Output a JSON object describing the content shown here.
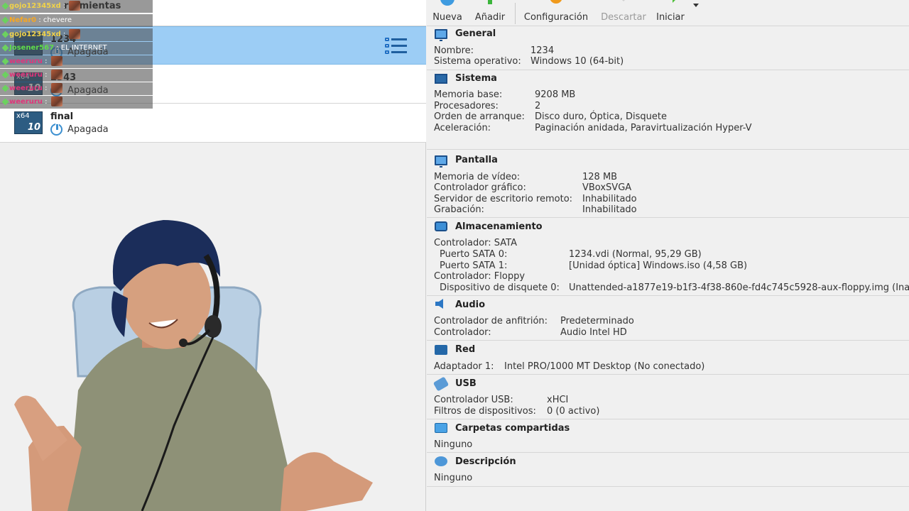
{
  "vm_list": {
    "tools_label": "rramientas",
    "selected": {
      "name": "1234",
      "state": "Apagada"
    },
    "items": [
      {
        "name": "2343",
        "state": "Apagada",
        "thumb_arch": "x64",
        "thumb_ver": "10"
      },
      {
        "name": "final",
        "state": "Apagada",
        "thumb_arch": "x64",
        "thumb_ver": "10"
      }
    ],
    "view_icon": "list-view-icon"
  },
  "chat": [
    {
      "user": "gojo12345xd",
      "msg": "",
      "user_color": "#f0d24a"
    },
    {
      "user": "Nefar0",
      "msg": "chevere",
      "user_color": "#f5a623"
    },
    {
      "user": "gojo12345xd",
      "msg": "",
      "user_color": "#f0d24a"
    },
    {
      "user": "Josener567",
      "msg": "EL INTERNET",
      "user_color": "#5fdc4a"
    },
    {
      "user": "weeruru",
      "msg": "",
      "user_color": "#e0357a"
    },
    {
      "user": "weeruru",
      "msg": "",
      "user_color": "#e0357a"
    },
    {
      "user": "weeruru",
      "msg": "",
      "user_color": "#e0357a"
    },
    {
      "user": "weeruru",
      "msg": "",
      "user_color": "#e0357a"
    }
  ],
  "toolbar": {
    "nueva": "Nueva",
    "anadir": "Añadir",
    "configuracion": "Configuración",
    "descartar": "Descartar",
    "iniciar": "Iniciar"
  },
  "details": {
    "general": {
      "title": "General",
      "rows": [
        {
          "k": "Nombre:",
          "v": "1234"
        },
        {
          "k": "Sistema operativo:",
          "v": "Windows 10 (64-bit)"
        }
      ]
    },
    "sistema": {
      "title": "Sistema",
      "rows": [
        {
          "k": "Memoria base:",
          "v": "9208 MB"
        },
        {
          "k": "Procesadores:",
          "v": "2"
        },
        {
          "k": "Orden de arranque:",
          "v": "Disco duro, Óptica, Disquete"
        },
        {
          "k": "Aceleración:",
          "v": "Paginación anidada, Paravirtualización Hyper-V"
        }
      ]
    },
    "pantalla": {
      "title": "Pantalla",
      "rows": [
        {
          "k": "Memoria de vídeo:",
          "v": "128 MB"
        },
        {
          "k": "Controlador gráfico:",
          "v": "VBoxSVGA"
        },
        {
          "k": "Servidor de escritorio remoto:",
          "v": "Inhabilitado"
        },
        {
          "k": "Grabación:",
          "v": "Inhabilitado"
        }
      ]
    },
    "almacenamiento": {
      "title": "Almacenamiento",
      "rows": [
        {
          "k": "Controlador: SATA",
          "v": ""
        },
        {
          "k": "Puerto SATA 0:",
          "v": "1234.vdi (Normal, 95,29 GB)"
        },
        {
          "k": "Puerto SATA 1:",
          "v": "[Unidad óptica] Windows.iso (4,58 GB)"
        },
        {
          "k": "Controlador: Floppy",
          "v": ""
        },
        {
          "k": "Dispositivo de disquete 0:",
          "v": "Unattended-a1877e19-b1f3-4f38-860e-fd4c745c5928-aux-floppy.img (Ina"
        }
      ]
    },
    "audio": {
      "title": "Audio",
      "rows": [
        {
          "k": "Controlador de anfitrión:",
          "v": "Predeterminado"
        },
        {
          "k": "Controlador:",
          "v": "Audio Intel HD"
        }
      ]
    },
    "red": {
      "title": "Red",
      "rows": [
        {
          "k": "Adaptador 1:",
          "v": "Intel PRO/1000 MT Desktop (No conectado)"
        }
      ]
    },
    "usb": {
      "title": "USB",
      "rows": [
        {
          "k": "Controlador USB:",
          "v": "xHCI"
        },
        {
          "k": "Filtros de dispositivos:",
          "v": "0 (0 activo)"
        }
      ]
    },
    "carpetas": {
      "title": "Carpetas compartidas",
      "rows": [
        {
          "k": "Ninguno",
          "v": ""
        }
      ]
    },
    "descripcion": {
      "title": "Descripción",
      "rows": [
        {
          "k": "Ninguno",
          "v": ""
        }
      ]
    }
  },
  "colors": {
    "selection": "#9ccdf5",
    "accent": "#1f6fc4"
  }
}
